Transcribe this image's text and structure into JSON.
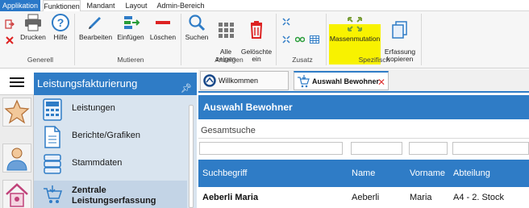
{
  "menu": {
    "tabs": [
      "Applikation",
      "Funktionen",
      "Mandant",
      "Layout",
      "Admin-Bereich"
    ]
  },
  "ribbon": {
    "groups": {
      "generell": {
        "label": "Generell",
        "buttons": [
          "Drucken",
          "Hilfe"
        ]
      },
      "mutieren": {
        "label": "Mutieren",
        "buttons": [
          "Bearbeiten",
          "Einfügen",
          "Löschen"
        ]
      },
      "anzeigen": {
        "label": "Anzeigen",
        "buttons": [
          "Suchen",
          "Alle\nzeigen",
          "Gelöschte\nein"
        ]
      },
      "zusatz": {
        "label": "Zusatz"
      },
      "spezifisch": {
        "label": "Spezifisch",
        "buttons": [
          "Massenmutation",
          "Erfassung\nkopieren"
        ]
      }
    },
    "highlight_color": "#f8f200"
  },
  "nav": {
    "title": "Leistungsfakturierung",
    "items": [
      "Leistungen",
      "Berichte/Grafiken",
      "Stammdaten",
      "Zentrale\nLeistungserfassung"
    ],
    "selected_index": 3
  },
  "doctabs": {
    "tabs": [
      "Willkommen",
      "Auswahl Bewohner"
    ],
    "active_index": 1
  },
  "main": {
    "title": "Auswahl Bewohner",
    "search_label": "Gesamtsuche",
    "columns": [
      "Suchbegriff",
      "Name",
      "Vorname",
      "Abteilung"
    ],
    "rows": [
      [
        "Aeberli Maria",
        "Aeberli",
        "Maria",
        "A4 - 2. Stock"
      ]
    ]
  },
  "colors": {
    "accent": "#2f7cc6",
    "nav_bg": "#d9e4ef"
  }
}
